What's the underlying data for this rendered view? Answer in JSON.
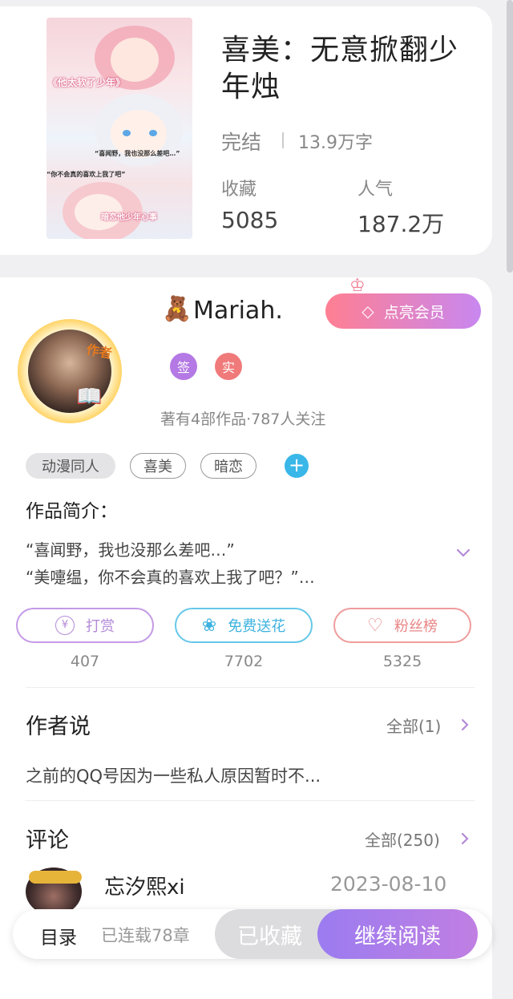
{
  "book": {
    "title": "喜美：无意掀翻少年烛",
    "status": "完结",
    "words": "13.9万字",
    "favorites_label": "收藏",
    "favorites_value": "5085",
    "popularity_label": "人气",
    "popularity_value": "187.2万",
    "cover_text": [
      "《他太软了少年》",
      "“喜闻野，我也没那么差吧…”",
      "“你不会真的喜欢上我了吧”",
      "暗恋他少年心事"
    ]
  },
  "author": {
    "name": "Mariah.",
    "tag": "作者",
    "badges": [
      "签",
      "实"
    ],
    "stats": "著有4部作品·787人关注",
    "vip_button": "点亮会员"
  },
  "tags": [
    "动漫同人",
    "喜美",
    "暗恋"
  ],
  "intro": {
    "title": "作品简介：",
    "line1": "“喜闻野，我也没那么差吧…”",
    "line2": "“美嚏缊，你不会真的喜欢上我了吧？”…"
  },
  "actions": [
    {
      "icon": "¥",
      "label": "打赏",
      "count": "407"
    },
    {
      "icon": "❀",
      "label": "免费送花",
      "count": "7702"
    },
    {
      "icon": "♡",
      "label": "粉丝榜",
      "count": "5325"
    }
  ],
  "author_says": {
    "title": "作者说",
    "all": "全部(1)",
    "text": "之前的QQ号因为一些私人原因暂时不..."
  },
  "comments": {
    "title": "评论",
    "all": "全部(250)",
    "first": {
      "name": "忘汐熙xi",
      "date": "2023-08-10"
    }
  },
  "bottom_bar": {
    "toc": "目录",
    "chapters": "已连载78章",
    "collected": "已收藏",
    "read": "继续阅读"
  }
}
